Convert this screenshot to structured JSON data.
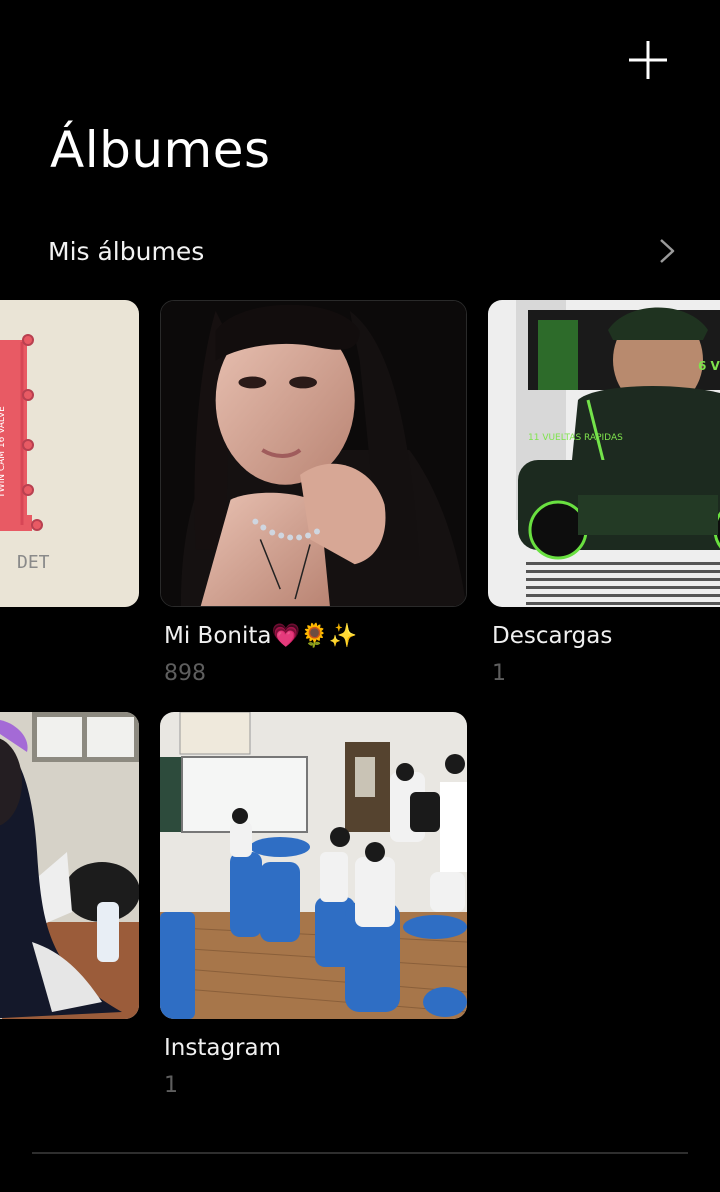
{
  "header": {
    "add_icon": "plus-icon",
    "title": "Álbumes"
  },
  "section": {
    "label": "Mis álbumes",
    "chevron_icon": "chevron-right-icon"
  },
  "albums": [
    {
      "name": "",
      "count": "",
      "thumb": "engine-illustration"
    },
    {
      "name": "Mi Bonita💗🌻✨",
      "count": "898",
      "thumb": "portrait-photo"
    },
    {
      "name": "Descargas",
      "count": "1",
      "thumb": "racing-poster"
    },
    {
      "name": "",
      "count": "",
      "thumb": "room-photo"
    },
    {
      "name": "Instagram",
      "count": "1",
      "thumb": "classroom-photo"
    }
  ],
  "theme": {
    "background": "#000000",
    "text_primary": "#f0f0f0",
    "text_secondary": "#5e5e5e"
  }
}
